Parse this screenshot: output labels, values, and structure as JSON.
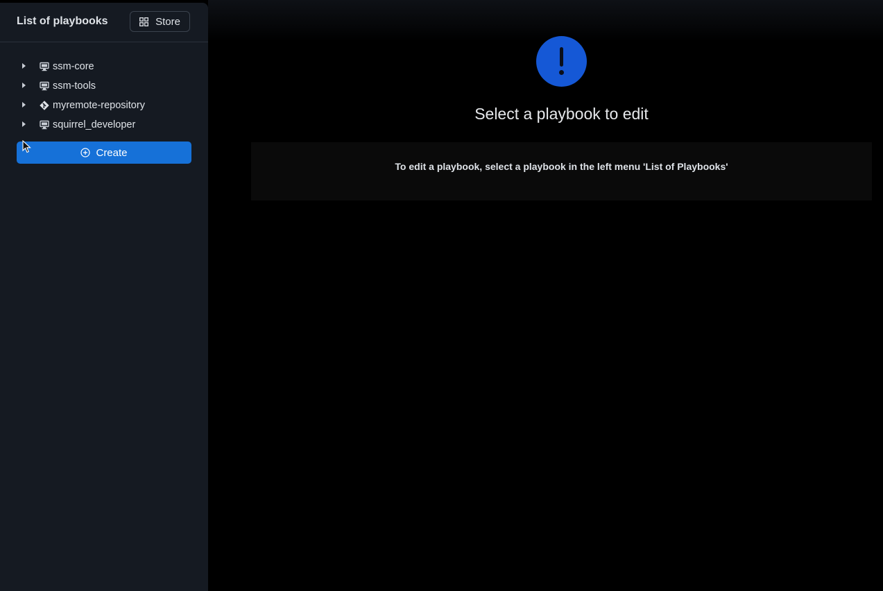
{
  "sidebar": {
    "title": "List of playbooks",
    "store_label": "Store",
    "items": [
      {
        "label": "ssm-core",
        "icon": "desktop-icon"
      },
      {
        "label": "ssm-tools",
        "icon": "desktop-icon"
      },
      {
        "label": "myremote-repository",
        "icon": "git-icon"
      },
      {
        "label": "squirrel_developer",
        "icon": "desktop-icon"
      }
    ],
    "create_label": "Create"
  },
  "main": {
    "title": "Select a playbook to edit",
    "info": "To edit a playbook, select a playbook in the left menu 'List of Playbooks'"
  },
  "colors": {
    "accent": "#1671d8",
    "alert": "#1558d6",
    "sidebar_bg": "#151a22",
    "page_bg": "#000000"
  }
}
